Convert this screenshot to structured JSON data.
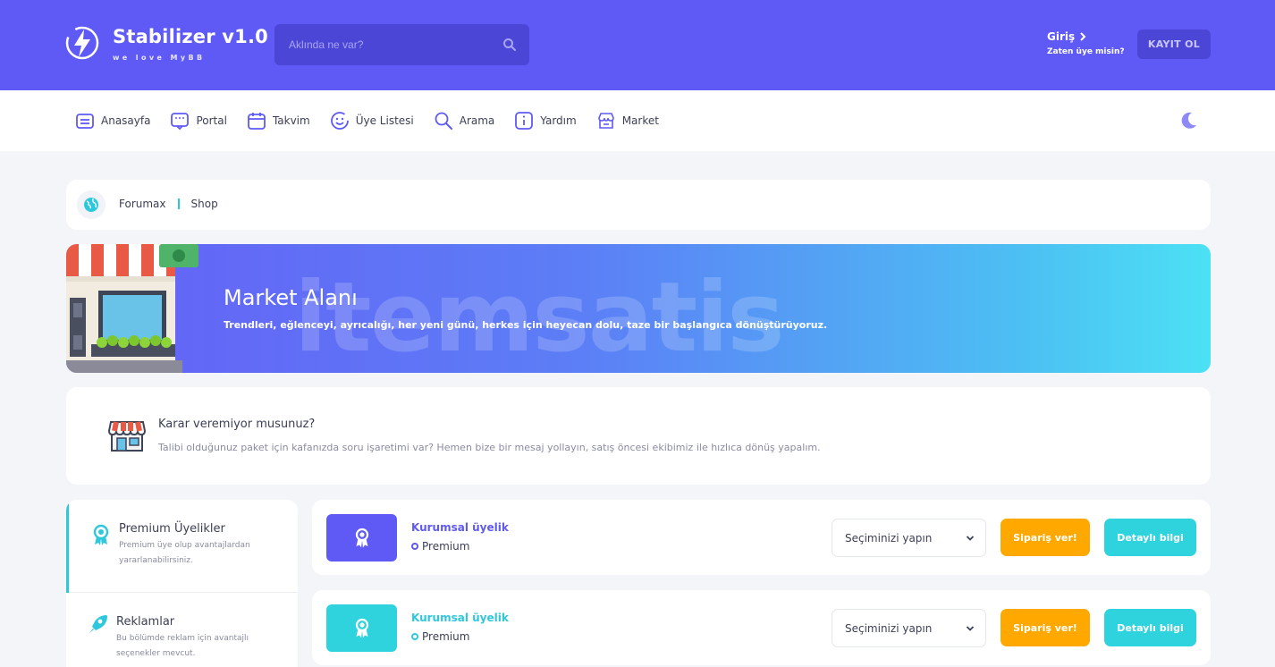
{
  "header": {
    "logo_title": "Stabilizer v1.0",
    "logo_subtitle": "we love MyBB",
    "search_placeholder": "Aklında ne var?",
    "login_label": "Giriş",
    "login_sub": "Zaten üye misin?",
    "register_label": "KAYIT OL",
    "accent_color": "#5f5af6"
  },
  "nav": {
    "items": [
      {
        "label": "Anasayfa",
        "icon": "home-icon"
      },
      {
        "label": "Portal",
        "icon": "portal-icon"
      },
      {
        "label": "Takvim",
        "icon": "calendar-icon"
      },
      {
        "label": "Üye Listesi",
        "icon": "smile-icon"
      },
      {
        "label": "Arama",
        "icon": "search-icon"
      },
      {
        "label": "Yardım",
        "icon": "info-icon"
      },
      {
        "label": "Market",
        "icon": "store-icon"
      }
    ],
    "theme_icon": "moon-icon"
  },
  "breadcrumb": {
    "items": [
      "Forumax",
      "Shop"
    ]
  },
  "banner": {
    "title": "Market Alanı",
    "description": "Trendleri, eğlenceyi, ayrıcalığı, her yeni günü, herkes için heyecan dolu, taze bir başlangıca dönüştürüyoruz.",
    "watermark": "itemsatis"
  },
  "info": {
    "title": "Karar veremiyor musunuz?",
    "description": "Talibi olduğunuz paket için kafanızda soru işaretimi var? Hemen bize bir mesaj yollayın, satış öncesi ekibimiz ile hızlıca dönüş yapalım."
  },
  "sidebar": {
    "items": [
      {
        "title": "Premium Üyelikler",
        "desc": "Premium üye olup avantajlardan yararlanabilirsiniz.",
        "icon": "award-icon"
      },
      {
        "title": "Reklamlar",
        "desc": "Bu bölümde reklam için avantajlı seçenekler mevcut.",
        "icon": "rocket-icon"
      }
    ]
  },
  "products": [
    {
      "name": "Kurumsal üyelik",
      "tag": "Premium",
      "select": "Seçiminizi yapın",
      "order": "Sipariş ver!",
      "detail": "Detaylı bilgi",
      "color": "#5f5af6"
    },
    {
      "name": "Kurumsal üyelik",
      "tag": "Premium",
      "select": "Seçiminizi yapın",
      "order": "Sipariş ver!",
      "detail": "Detaylı bilgi",
      "color": "#2ed3dd"
    }
  ]
}
